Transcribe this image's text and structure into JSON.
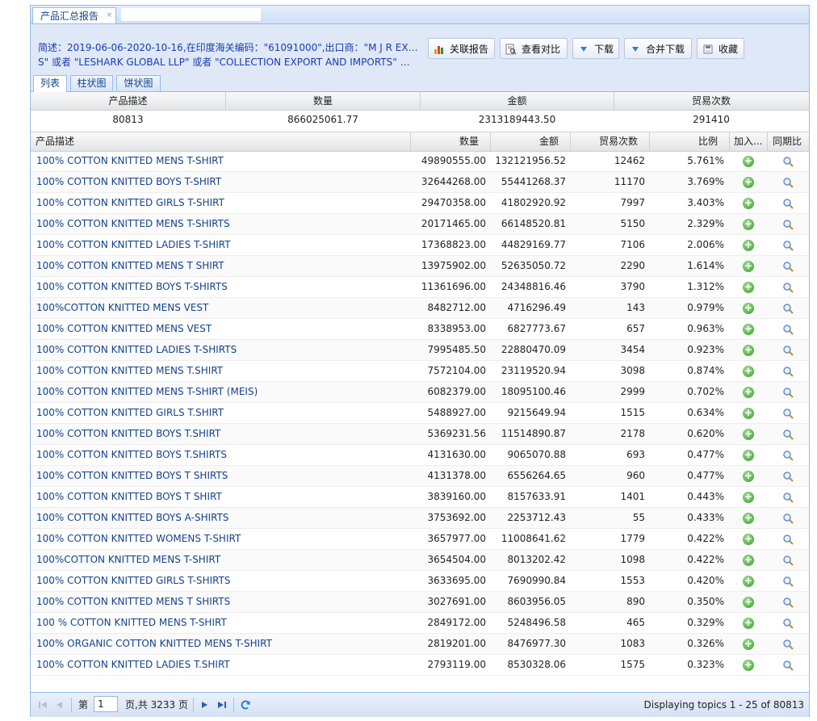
{
  "tab": {
    "title": "产品汇总报告",
    "close": "×"
  },
  "description": {
    "line1": "简述：2019-06-06-2020-10-16,在印度海关编码：\"61091000\",出口商：\"M J R EXPORT",
    "line2": "S\" 或者 \"LESHARK GLOBAL LLP\" 或者 \"COLLECTION EXPORT AND IMPORTS\" 或者 \"J..."
  },
  "toolbar": {
    "related": "关联报告",
    "compare": "查看对比",
    "download": "下载",
    "merge_download": "合并下载",
    "favorite": "收藏"
  },
  "subtabs": [
    "列表",
    "柱状图",
    "饼状图"
  ],
  "summary": {
    "headers": [
      "产品描述",
      "数量",
      "金额",
      "贸易次数"
    ],
    "values": [
      "80813",
      "866025061.77",
      "2313189443.50",
      "291410"
    ]
  },
  "grid": {
    "headers": [
      "产品描述",
      "数量",
      "金额",
      "贸易次数",
      "比例",
      "加入...",
      "同期比"
    ],
    "rows": [
      [
        "100% COTTON KNITTED MENS T-SHIRT",
        "49890555.00",
        "132121956.52",
        "12462",
        "5.761%"
      ],
      [
        "100% COTTON KNITTED BOYS T-SHIRT",
        "32644268.00",
        "55441268.37",
        "11170",
        "3.769%"
      ],
      [
        "100% COTTON KNITTED GIRLS T-SHIRT",
        "29470358.00",
        "41802920.92",
        "7997",
        "3.403%"
      ],
      [
        "100% COTTON KNITTED MENS T-SHIRTS",
        "20171465.00",
        "66148520.81",
        "5150",
        "2.329%"
      ],
      [
        "100% COTTON KNITTED LADIES T-SHIRT",
        "17368823.00",
        "44829169.77",
        "7106",
        "2.006%"
      ],
      [
        "100% COTTON KNITTED MENS T SHIRT",
        "13975902.00",
        "52635050.72",
        "2290",
        "1.614%"
      ],
      [
        "100% COTTON KNITTED BOYS T-SHIRTS",
        "11361696.00",
        "24348816.46",
        "3790",
        "1.312%"
      ],
      [
        "100%COTTON KNITTED MENS VEST",
        "8482712.00",
        "4716296.49",
        "143",
        "0.979%"
      ],
      [
        "100% COTTON KNITTED MENS VEST",
        "8338953.00",
        "6827773.67",
        "657",
        "0.963%"
      ],
      [
        "100% COTTON KNITTED LADIES T-SHIRTS",
        "7995485.50",
        "22880470.09",
        "3454",
        "0.923%"
      ],
      [
        "100% COTTON KNITTED MENS T.SHIRT",
        "7572104.00",
        "23119520.94",
        "3098",
        "0.874%"
      ],
      [
        "100% COTTON KNITTED MENS T-SHIRT (MEIS)",
        "6082379.00",
        "18095100.46",
        "2999",
        "0.702%"
      ],
      [
        "100% COTTON KNITTED GIRLS T.SHIRT",
        "5488927.00",
        "9215649.94",
        "1515",
        "0.634%"
      ],
      [
        "100% COTTON KNITTED BOYS T.SHIRT",
        "5369231.56",
        "11514890.87",
        "2178",
        "0.620%"
      ],
      [
        "100% COTTON KNITTED BOYS T.SHIRTS",
        "4131630.00",
        "9065070.88",
        "693",
        "0.477%"
      ],
      [
        "100% COTTON KNITTED BOYS T SHIRTS",
        "4131378.00",
        "6556264.65",
        "960",
        "0.477%"
      ],
      [
        "100% COTTON KNITTED BOYS T SHIRT",
        "3839160.00",
        "8157633.91",
        "1401",
        "0.443%"
      ],
      [
        "100% COTTON KNITTED BOYS A-SHIRTS",
        "3753692.00",
        "2253712.43",
        "55",
        "0.433%"
      ],
      [
        "100% COTTON KNITTED WOMENS T-SHIRT",
        "3657977.00",
        "11008641.62",
        "1779",
        "0.422%"
      ],
      [
        "100%COTTON KNITTED MENS T-SHIRT",
        "3654504.00",
        "8013202.42",
        "1098",
        "0.422%"
      ],
      [
        "100% COTTON KNITTED GIRLS T-SHIRTS",
        "3633695.00",
        "7690990.84",
        "1553",
        "0.420%"
      ],
      [
        "100% COTTON KNITTED MENS T SHIRTS",
        "3027691.00",
        "8603956.05",
        "890",
        "0.350%"
      ],
      [
        "100 % COTTON KNITTED MENS T-SHIRT",
        "2849172.00",
        "5248496.58",
        "465",
        "0.329%"
      ],
      [
        "100% ORGANIC COTTON KNITTED MENS T-SHIRT",
        "2819201.00",
        "8476977.30",
        "1083",
        "0.326%"
      ],
      [
        "100% COTTON KNITTED LADIES T.SHIRT",
        "2793119.00",
        "8530328.06",
        "1575",
        "0.323%"
      ]
    ]
  },
  "pager": {
    "page_prefix": "第",
    "page_value": "1",
    "page_suffix": "页,共 3233 页",
    "info": "Displaying topics 1 - 25 of 80813"
  },
  "colors": {
    "accent": "#15428b",
    "border": "#99bbe8",
    "desc": "#1a3bb4"
  }
}
